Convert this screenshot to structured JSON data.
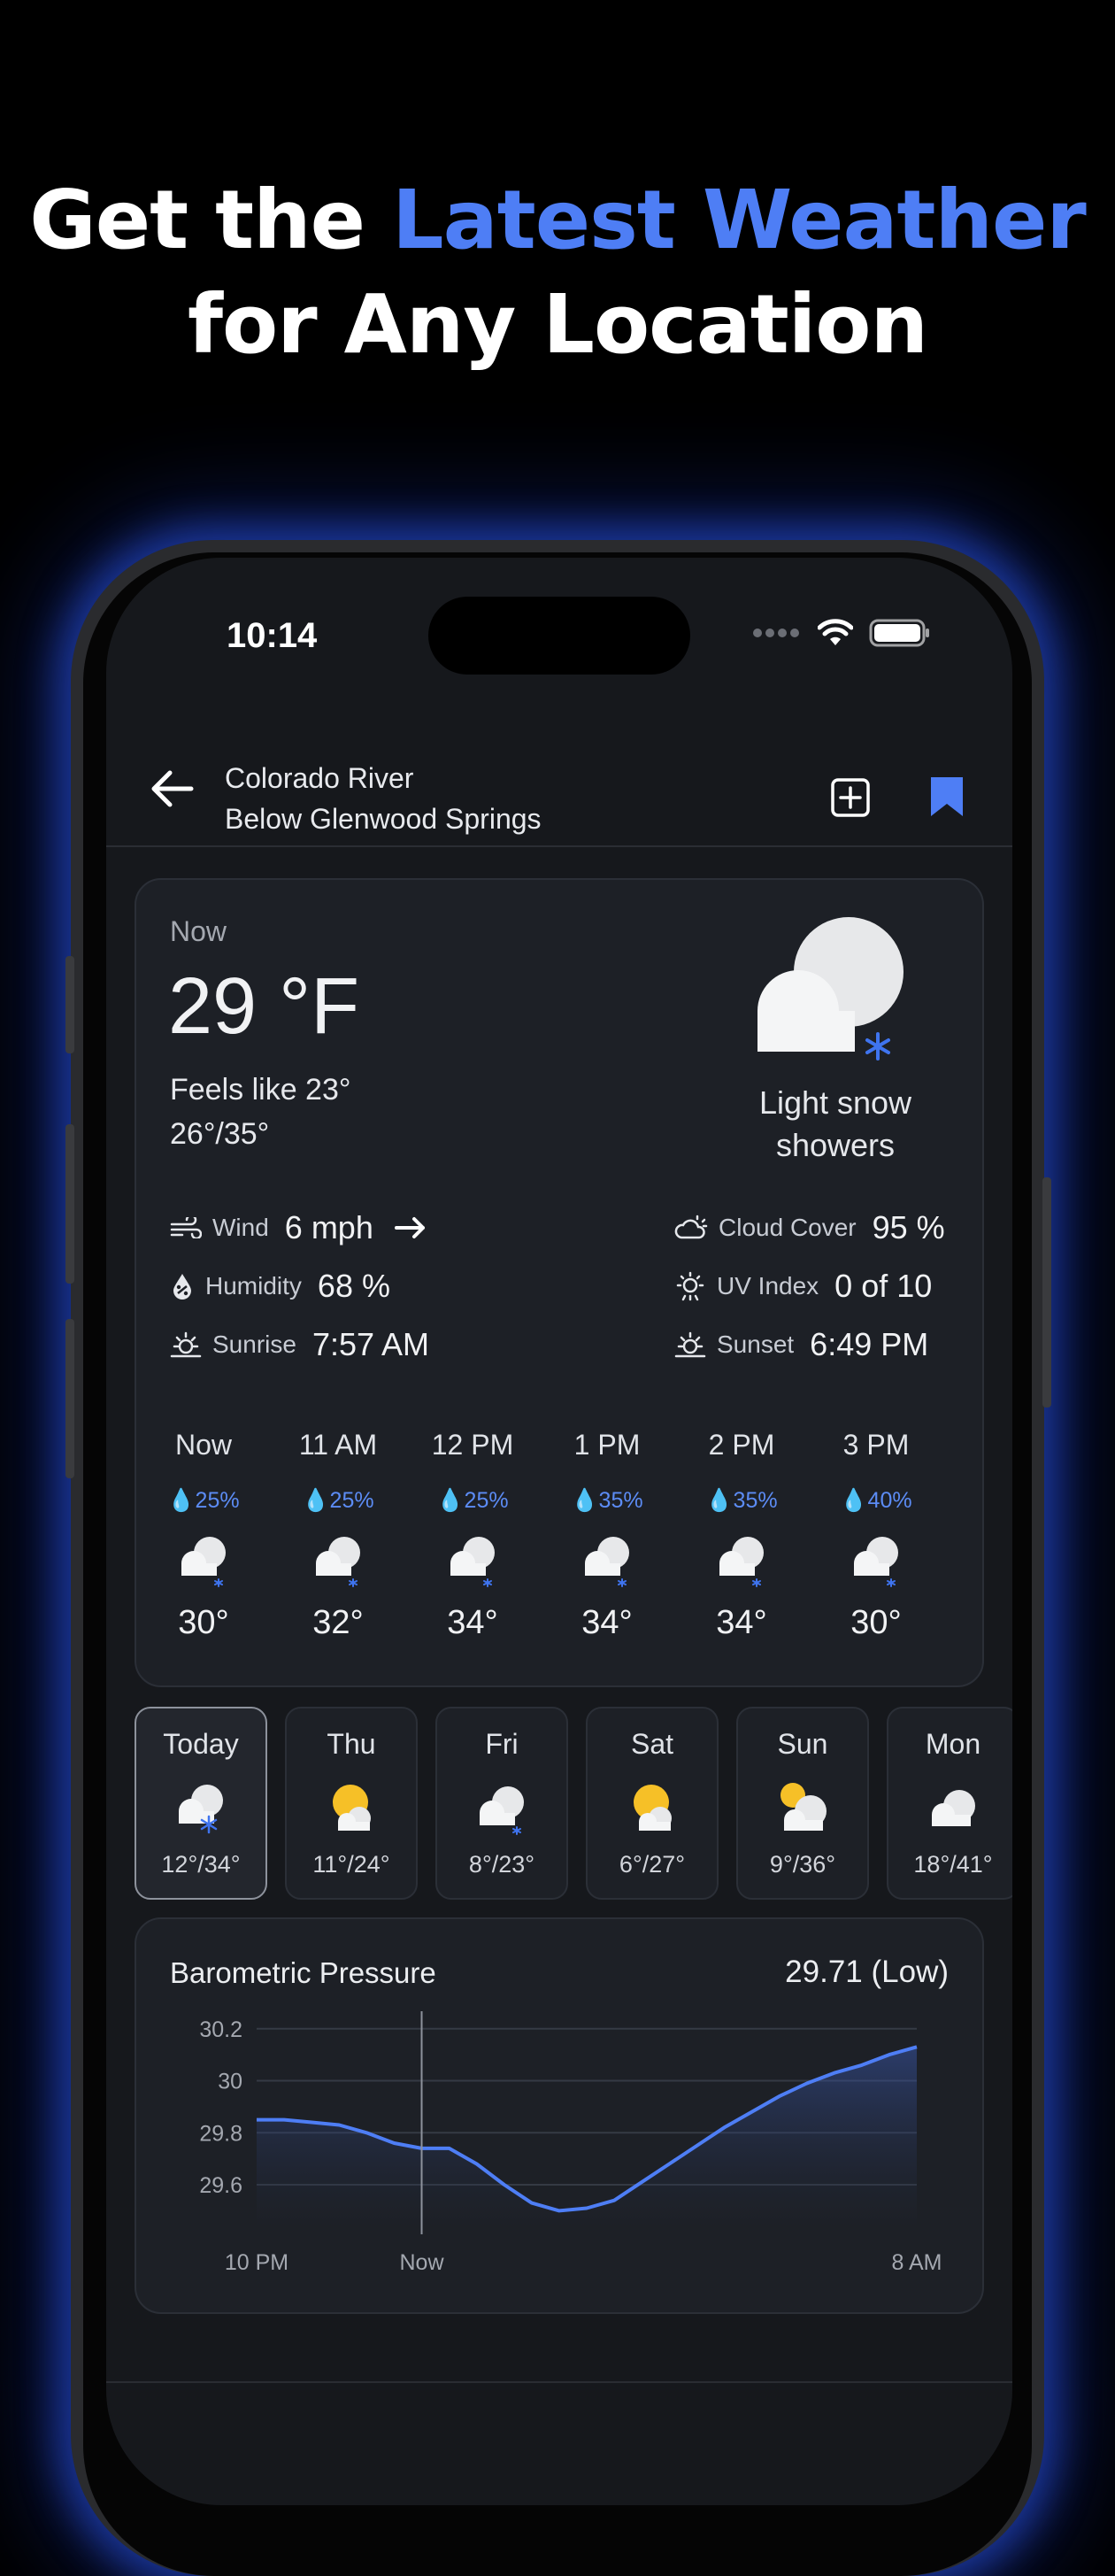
{
  "headline": {
    "part1": "Get the ",
    "accent": "Latest Weather",
    "line2": "for Any Location"
  },
  "colors": {
    "accent": "#4e7ef5",
    "background": "#000000",
    "card": "#1d2026"
  },
  "status_bar": {
    "time": "10:14"
  },
  "header": {
    "location_line1": "Colorado River",
    "location_line2": "Below Glenwood Springs",
    "icons": [
      "back-arrow-icon",
      "add-icon",
      "bookmark-icon"
    ]
  },
  "current": {
    "label": "Now",
    "temperature": "29 °F",
    "feels_like": "Feels like 23°",
    "hi_lo": "26°/35°",
    "condition": "Light snow showers",
    "details": {
      "wind_label": "Wind",
      "wind_value": "6 mph",
      "humidity_label": "Humidity",
      "humidity_value": "68 %",
      "sunrise_label": "Sunrise",
      "sunrise_value": "7:57 AM",
      "cloud_label": "Cloud Cover",
      "cloud_value": "95 %",
      "uv_label": "UV Index",
      "uv_value": "0 of 10",
      "sunset_label": "Sunset",
      "sunset_value": "6:49 PM"
    }
  },
  "hourly": [
    {
      "time": "Now",
      "precip": "25%",
      "temp": "30°"
    },
    {
      "time": "11 AM",
      "precip": "25%",
      "temp": "32°"
    },
    {
      "time": "12 PM",
      "precip": "25%",
      "temp": "34°"
    },
    {
      "time": "1 PM",
      "precip": "35%",
      "temp": "34°"
    },
    {
      "time": "2 PM",
      "precip": "35%",
      "temp": "34°"
    },
    {
      "time": "3 PM",
      "precip": "40%",
      "temp": "30°"
    }
  ],
  "daily": [
    {
      "day": "Today",
      "range": "12°/34°",
      "icon": "cloud-snow-icon"
    },
    {
      "day": "Thu",
      "range": "11°/24°",
      "icon": "partly-sunny-icon"
    },
    {
      "day": "Fri",
      "range": "8°/23°",
      "icon": "cloud-snow-icon"
    },
    {
      "day": "Sat",
      "range": "6°/27°",
      "icon": "partly-sunny-icon"
    },
    {
      "day": "Sun",
      "range": "9°/36°",
      "icon": "partly-sunny-icon"
    },
    {
      "day": "Mon",
      "range": "18°/41°",
      "icon": "cloud-icon"
    }
  ],
  "barometer": {
    "title": "Barometric Pressure",
    "current": "29.71 (Low)"
  },
  "chart_data": {
    "type": "area",
    "y_ticks": [
      "30.2",
      "30",
      "29.8",
      "29.6"
    ],
    "ylim": [
      29.43,
      30.24
    ],
    "x_labels": [
      "10 PM",
      "Now",
      "8 AM"
    ],
    "now_marker_x": 6,
    "x": [
      0,
      1,
      2,
      3,
      4,
      5,
      6,
      7,
      8,
      9,
      10,
      11,
      12,
      13,
      14,
      15,
      16,
      17,
      18,
      19,
      20,
      21,
      22,
      23,
      24
    ],
    "values": [
      29.85,
      29.85,
      29.84,
      29.83,
      29.8,
      29.76,
      29.74,
      29.74,
      29.68,
      29.6,
      29.53,
      29.5,
      29.51,
      29.54,
      29.61,
      29.68,
      29.75,
      29.82,
      29.88,
      29.94,
      29.99,
      30.03,
      30.06,
      30.1,
      30.13
    ]
  }
}
